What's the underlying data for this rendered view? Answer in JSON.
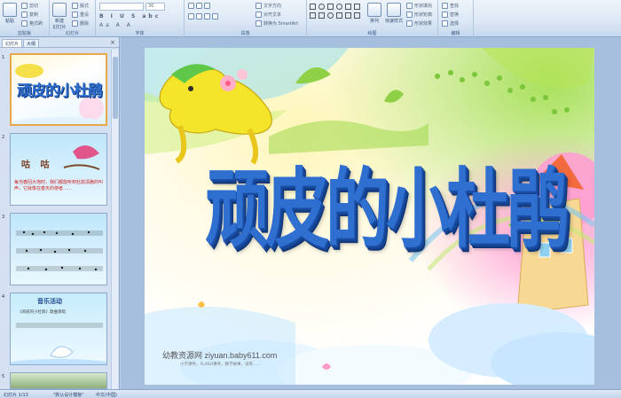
{
  "ribbon": {
    "paste": "粘贴",
    "cut": "剪切",
    "copy": "复制",
    "format_painter": "格式刷",
    "new_slide": "新建\n幻灯片",
    "layout": "版式",
    "reset": "重设",
    "delete": "删除",
    "font_size": "36",
    "text_direction": "文字方向",
    "align_text": "对齐文本",
    "smartart": "转换为 SmartArt",
    "arrange": "排列",
    "quick_styles": "快速样式",
    "shape_fill": "形状填充",
    "shape_outline": "形状轮廓",
    "shape_effects": "形状效果",
    "find": "查找",
    "replace": "替换",
    "select": "选择",
    "groups": [
      "剪贴板",
      "幻灯片",
      "字体",
      "段落",
      "绘图",
      "编辑"
    ]
  },
  "panel": {
    "tab_slides": "幻灯片",
    "tab_outline": "大纲",
    "slides": [
      {
        "num": "1",
        "title": "顽皮的小杜鹃"
      },
      {
        "num": "2",
        "title": "咕  咕",
        "text": "每当春回大地时，我们都能听到杜鹃清脆的叫声，它就像在春天的使者……"
      },
      {
        "num": "3"
      },
      {
        "num": "4",
        "title": "音乐活动",
        "text": "《顽皮的小杜鹃》歌曲演唱"
      },
      {
        "num": "5"
      }
    ]
  },
  "slide": {
    "title": "顽皮的小杜鹃",
    "site": "幼教资源网 ziyuan.baby611.com",
    "sub": "小学课件，FLASH课件，教学故事，试卷……"
  },
  "status": {
    "page": "幻灯片 1/13",
    "theme": "\"默认设计模板\"",
    "lang": "中文(中国)"
  }
}
